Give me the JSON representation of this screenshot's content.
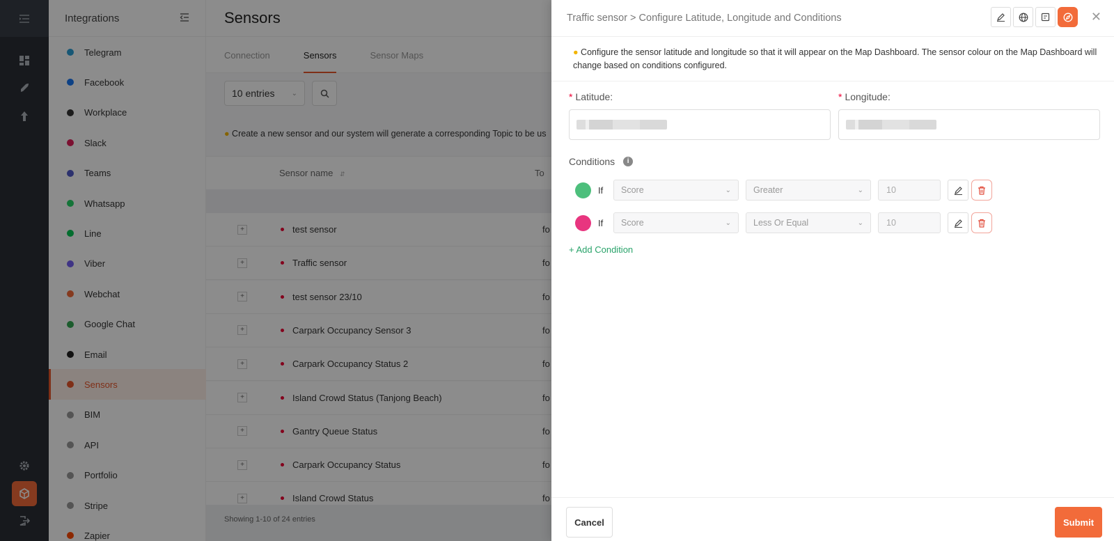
{
  "colors": {
    "accent": "#f26b3a",
    "green": "#4dbf7c",
    "pink": "#e8357f",
    "link": "#29a36a"
  },
  "sidebar": {
    "title": "Integrations",
    "items": [
      {
        "label": "Telegram",
        "icon": "telegram-icon",
        "color": "#2a9fd6"
      },
      {
        "label": "Facebook",
        "icon": "facebook-icon",
        "color": "#1877f2"
      },
      {
        "label": "Workplace",
        "icon": "workplace-icon",
        "color": "#333"
      },
      {
        "label": "Slack",
        "icon": "slack-icon",
        "color": "#e01e5a"
      },
      {
        "label": "Teams",
        "icon": "teams-icon",
        "color": "#5059c9"
      },
      {
        "label": "Whatsapp",
        "icon": "whatsapp-icon",
        "color": "#25d366"
      },
      {
        "label": "Line",
        "icon": "line-icon",
        "color": "#06c755"
      },
      {
        "label": "Viber",
        "icon": "viber-icon",
        "color": "#7360f2"
      },
      {
        "label": "Webchat",
        "icon": "webchat-icon",
        "color": "#f26b3a"
      },
      {
        "label": "Google Chat",
        "icon": "google-chat-icon",
        "color": "#34a853"
      },
      {
        "label": "Email",
        "icon": "email-icon",
        "color": "#222"
      },
      {
        "label": "Sensors",
        "icon": "sensors-icon",
        "color": "#e8562a"
      },
      {
        "label": "BIM",
        "icon": "bim-icon",
        "color": "#999"
      },
      {
        "label": "API",
        "icon": "api-icon",
        "color": "#999"
      },
      {
        "label": "Portfolio",
        "icon": "portfolio-icon",
        "color": "#999"
      },
      {
        "label": "Stripe",
        "icon": "stripe-icon",
        "color": "#999"
      },
      {
        "label": "Zapier",
        "icon": "zapier-icon",
        "color": "#ff4a00"
      }
    ]
  },
  "main": {
    "title": "Sensors",
    "tabs": [
      "Connection",
      "Sensors",
      "Sensor Maps"
    ],
    "entries_select": "10 entries",
    "hint": "Create a new sensor and our system will generate a corresponding Topic to be us",
    "column_sensor_name": "Sensor name",
    "column_topic": "To",
    "rows": [
      {
        "name": "test sensor",
        "topic": "fo"
      },
      {
        "name": "Traffic sensor",
        "topic": "fo"
      },
      {
        "name": "test sensor 23/10",
        "topic": "fo"
      },
      {
        "name": "Carpark Occupancy Sensor 3",
        "topic": "fo"
      },
      {
        "name": "Carpark Occupancy Status 2",
        "topic": "fo"
      },
      {
        "name": "Island Crowd Status (Tanjong Beach)",
        "topic": "fo"
      },
      {
        "name": "Gantry Queue Status",
        "topic": "fo"
      },
      {
        "name": "Carpark Occupancy Status",
        "topic": "fo"
      },
      {
        "name": "Island Crowd Status",
        "topic": "fo"
      }
    ],
    "footer": "Showing 1-10 of 24 entries"
  },
  "drawer": {
    "title": "Traffic sensor > Configure Latitude, Longitude and Conditions",
    "note": "Configure the sensor latitude and longitude so that it will appear on the Map Dashboard. The sensor colour on the Map Dashboard will change based on conditions configured.",
    "latitude_label": "Latitude",
    "longitude_label": "Longitude",
    "conditions_label": "Conditions",
    "conditions": [
      {
        "if": "If",
        "field": "Score",
        "operator": "Greater",
        "value": "10",
        "color": "#4dbf7c"
      },
      {
        "if": "If",
        "field": "Score",
        "operator": "Less Or Equal",
        "value": "10",
        "color": "#e8357f"
      }
    ],
    "add_condition": "+ Add Condition",
    "cancel": "Cancel",
    "submit": "Submit"
  }
}
